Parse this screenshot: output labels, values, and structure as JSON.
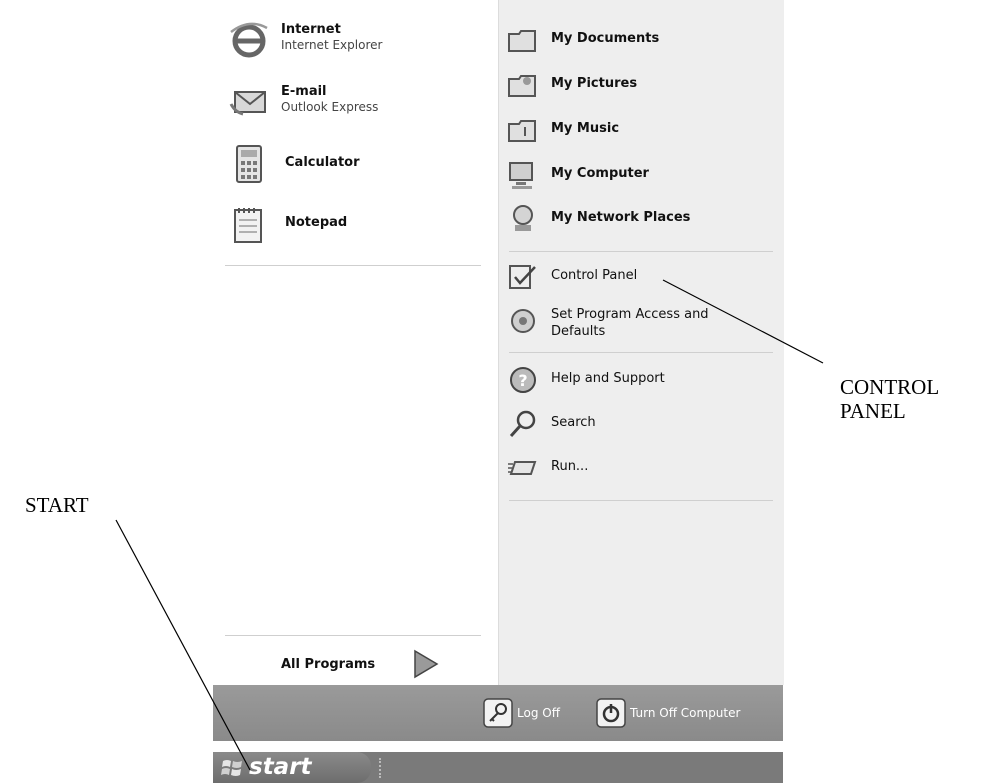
{
  "left_programs": [
    {
      "name": "Internet",
      "sub": "Internet Explorer",
      "icon": "internet-explorer-icon"
    },
    {
      "name": "E-mail",
      "sub": "Outlook Express",
      "icon": "outlook-express-icon"
    },
    {
      "name": "Calculator",
      "icon": "calculator-icon"
    },
    {
      "name": "Notepad",
      "icon": "notepad-icon"
    }
  ],
  "all_programs": {
    "label": "All Programs",
    "icon": "green-arrow-icon"
  },
  "right_places": [
    {
      "label": "My Documents",
      "icon": "folder-icon"
    },
    {
      "label": "My Pictures",
      "icon": "folder-icon"
    },
    {
      "label": "My Music",
      "icon": "folder-icon"
    },
    {
      "label": "My Computer",
      "icon": "computer-icon"
    },
    {
      "label": "My Network Places",
      "icon": "network-icon"
    }
  ],
  "right_settings": [
    {
      "label": "Control Panel",
      "icon": "control-panel-icon"
    },
    {
      "label": "Set Program Access and Defaults",
      "line1": "Set Program Access and",
      "line2": "Defaults",
      "icon": "program-access-icon"
    }
  ],
  "right_tools": [
    {
      "label": "Help and Support",
      "icon": "help-icon"
    },
    {
      "label": "Search",
      "icon": "search-icon"
    },
    {
      "label": "Run...",
      "icon": "run-icon"
    }
  ],
  "bottom": {
    "log_off": "Log Off",
    "turn_off": "Turn Off Computer"
  },
  "taskbar": {
    "start": "start"
  },
  "annotations": {
    "start": "START",
    "control_panel_1": "CONTROL",
    "control_panel_2": "PANEL"
  }
}
